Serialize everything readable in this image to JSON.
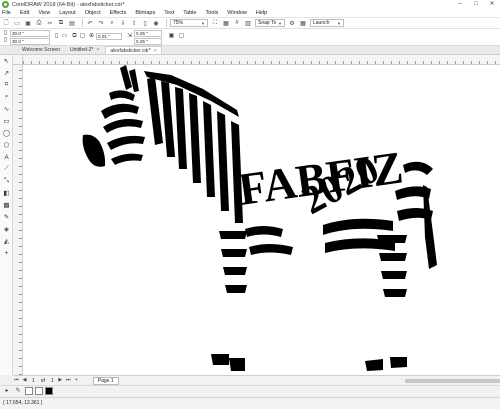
{
  "window": {
    "title": "CorelDRAW 2018 (64-Bit) - alexfabsticker.cdr*"
  },
  "menu": [
    "File",
    "Edit",
    "View",
    "Layout",
    "Object",
    "Effects",
    "Bitmaps",
    "Text",
    "Table",
    "Tools",
    "Window",
    "Help"
  ],
  "toolbar": {
    "zoom": "75%",
    "snap_label": "Snap To",
    "launch_label": "Launch"
  },
  "properties": {
    "width": "30.0 \"",
    "height": "30.0 \"",
    "nudge": "0.01 \"",
    "dup_x": "0.25 \"",
    "dup_y": "0.25 \""
  },
  "tabs": [
    {
      "label": "Welcome Screen",
      "closable": false
    },
    {
      "label": "Untitled-2*",
      "closable": true
    },
    {
      "label": "alexfabsticker.cdr*",
      "closable": true
    }
  ],
  "pager": {
    "page_index": "1",
    "of_label": "of",
    "page_count": "1",
    "page_tab": "Page 1"
  },
  "status": {
    "coordinates": "( 17.654, 13.361 )"
  },
  "artwork": {
    "letters_1": "FABFIZ",
    "letters_2": "2020"
  },
  "colors": {
    "accent": "#2d7ff0",
    "ink": "#000000",
    "canvas": "#ffffff"
  },
  "icons": {
    "app": "coreldraw-logo-icon",
    "tools": [
      "pick-tool-icon",
      "shape-tool-icon",
      "crop-tool-icon",
      "zoom-tool-icon",
      "freehand-tool-icon",
      "rectangle-tool-icon",
      "ellipse-tool-icon",
      "polygon-tool-icon",
      "text-tool-icon",
      "parallel-dimension-icon",
      "connector-tool-icon",
      "drop-shadow-tool-icon",
      "transparency-tool-icon",
      "eyedropper-tool-icon",
      "interactive-fill-icon",
      "smart-fill-icon",
      "add-tool-icon"
    ]
  }
}
